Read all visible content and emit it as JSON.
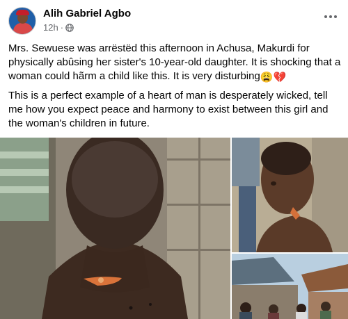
{
  "post": {
    "author": "Alih Gabriel Agbo",
    "time": "12h",
    "separator": "·",
    "privacy_icon": "globe-icon",
    "paragraphs": [
      "Mrs. Sewuese was arrëstëd this afternoon in Achusa, Makurdi for physically abûsing her sister's 10-year-old daughter. It is shocking that a woman could hãrm a child like this. It is very disturbing",
      "This is a perfect example of a heart of man is desperately wicked, tell me how you expect peace and harmony to exist between this girl and the woman's children in future."
    ],
    "emojis": [
      "😩",
      "💔"
    ]
  },
  "photos": [
    {
      "name": "photo-child-back-injury"
    },
    {
      "name": "photo-child-neck-injury"
    },
    {
      "name": "photo-crowd-outside"
    }
  ],
  "colors": {
    "text_primary": "#050505",
    "text_secondary": "#65676b",
    "background": "#ffffff"
  }
}
